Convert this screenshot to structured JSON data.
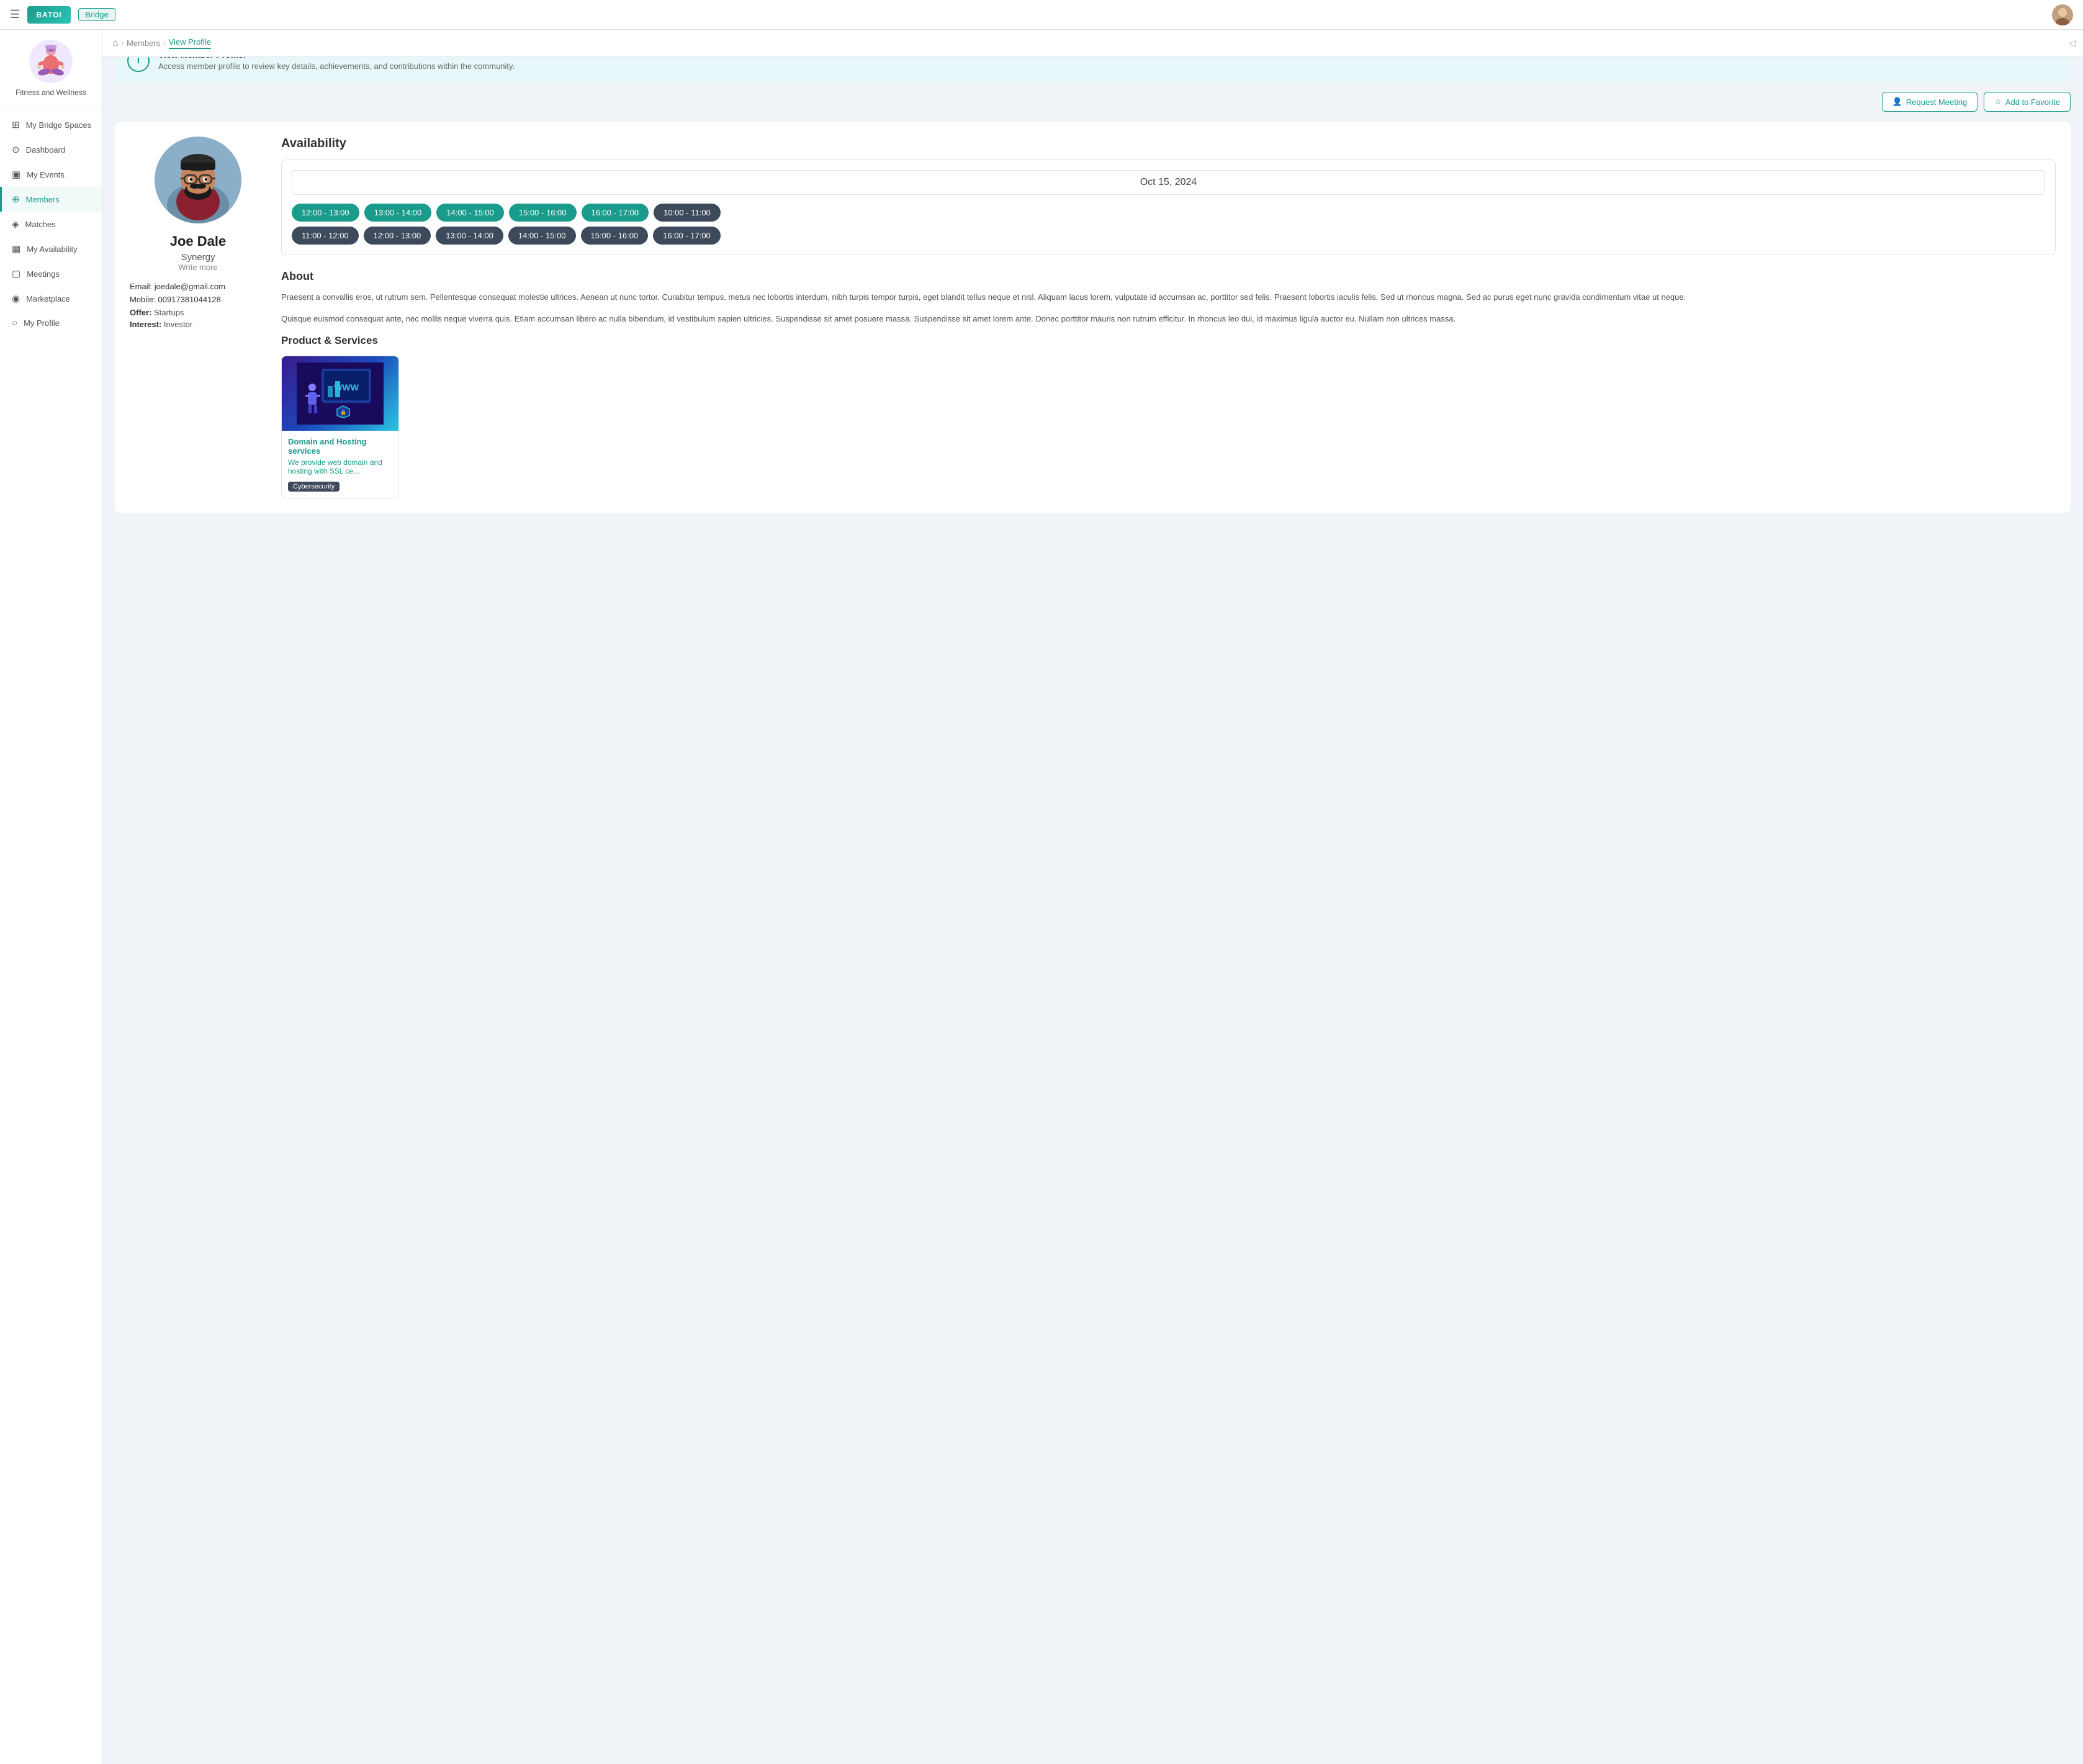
{
  "app": {
    "logo_text": "BATOI",
    "bridge_label": "Bridge",
    "hamburger_icon": "☰",
    "collapse_icon": "◁"
  },
  "topnav": {
    "avatar_alt": "User Avatar"
  },
  "sidebar": {
    "space_name": "Fitness and Wellness",
    "my_bridge_spaces_label": "My Bridge Spaces",
    "nav_items": [
      {
        "id": "dashboard",
        "label": "Dashboard",
        "icon": "⊙"
      },
      {
        "id": "my-events",
        "label": "My Events",
        "icon": "▣"
      },
      {
        "id": "members",
        "label": "Members",
        "icon": "⊕",
        "active": true
      },
      {
        "id": "matches",
        "label": "Matches",
        "icon": "◈"
      },
      {
        "id": "my-availability",
        "label": "My Availability",
        "icon": "▦"
      },
      {
        "id": "meetings",
        "label": "Meetings",
        "icon": "▢"
      },
      {
        "id": "marketplace",
        "label": "Marketplace",
        "icon": "◉"
      },
      {
        "id": "my-profile",
        "label": "My Profile",
        "icon": "○"
      }
    ]
  },
  "breadcrumb": {
    "home_icon": "⌂",
    "items": [
      {
        "label": "Members",
        "active": false
      },
      {
        "label": "View Profile",
        "active": true
      }
    ]
  },
  "info_banner": {
    "icon": "i",
    "title": "View Member Profile!",
    "description": "Access member profile to review key details, achievements, and contributions within the community."
  },
  "actions": {
    "request_meeting_label": "Request Meeting",
    "add_to_favorite_label": "Add to Favorite",
    "meeting_icon": "👤",
    "star_icon": "☆"
  },
  "member": {
    "name": "Joe Dale",
    "company": "Synergy",
    "write_more": "Write more",
    "email_label": "Email:",
    "email_value": "joedale@gmail.com",
    "mobile_label": "Mobile:",
    "mobile_value": "00917381044128",
    "offer_label": "Offer:",
    "offer_value": "Startups",
    "interest_label": "Interest:",
    "interest_value": "Investor"
  },
  "availability": {
    "section_title": "Availability",
    "date": "Oct 15, 2024",
    "slots_row1": [
      {
        "time": "12:00 - 13:00",
        "style": "teal"
      },
      {
        "time": "13:00 - 14:00",
        "style": "teal"
      },
      {
        "time": "14:00 - 15:00",
        "style": "teal"
      },
      {
        "time": "15:00 - 16:00",
        "style": "teal"
      },
      {
        "time": "16:00 - 17:00",
        "style": "teal"
      },
      {
        "time": "10:00 - 11:00",
        "style": "dark"
      }
    ],
    "slots_row2": [
      {
        "time": "11:00 - 12:00",
        "style": "dark"
      },
      {
        "time": "12:00 - 13:00",
        "style": "dark"
      },
      {
        "time": "13:00 - 14:00",
        "style": "dark"
      },
      {
        "time": "14:00 - 15:00",
        "style": "dark"
      },
      {
        "time": "15:00 - 16:00",
        "style": "dark"
      },
      {
        "time": "16:00 - 17:00",
        "style": "dark"
      }
    ]
  },
  "about": {
    "title": "About",
    "paragraph1": "Praesent a convallis eros, ut rutrum sem. Pellentesque consequat molestie ultrices. Aenean ut nunc tortor. Curabitur tempus, metus nec lobortis interdum, nibh turpis tempor turpis, eget blandit tellus neque et nisl. Aliquam lacus lorem, vulputate id accumsan ac, porttitor sed felis. Praesent lobortis iaculis felis. Sed ut rhoncus magna. Sed ac purus eget nunc gravida condimentum vitae ut neque.",
    "paragraph2": "Quisque euismod consequat ante, nec mollis neque viverra quis. Etiam accumsan libero ac nulla bibendum, id vestibulum sapien ultricies. Suspendisse sit amet posuere massa. Suspendisse sit amet lorem ante. Donec porttitor mauris non rutrum efficitur. In rhoncus leo dui, id maximus ligula auctor eu. Nullam non ultrices massa."
  },
  "products": {
    "title": "Product & Services",
    "card": {
      "name": "Domain and Hosting services",
      "description": "We provide web domain and hosting with SSL ce...",
      "badge": "Cybersecurity",
      "img_label": "WWW"
    }
  }
}
